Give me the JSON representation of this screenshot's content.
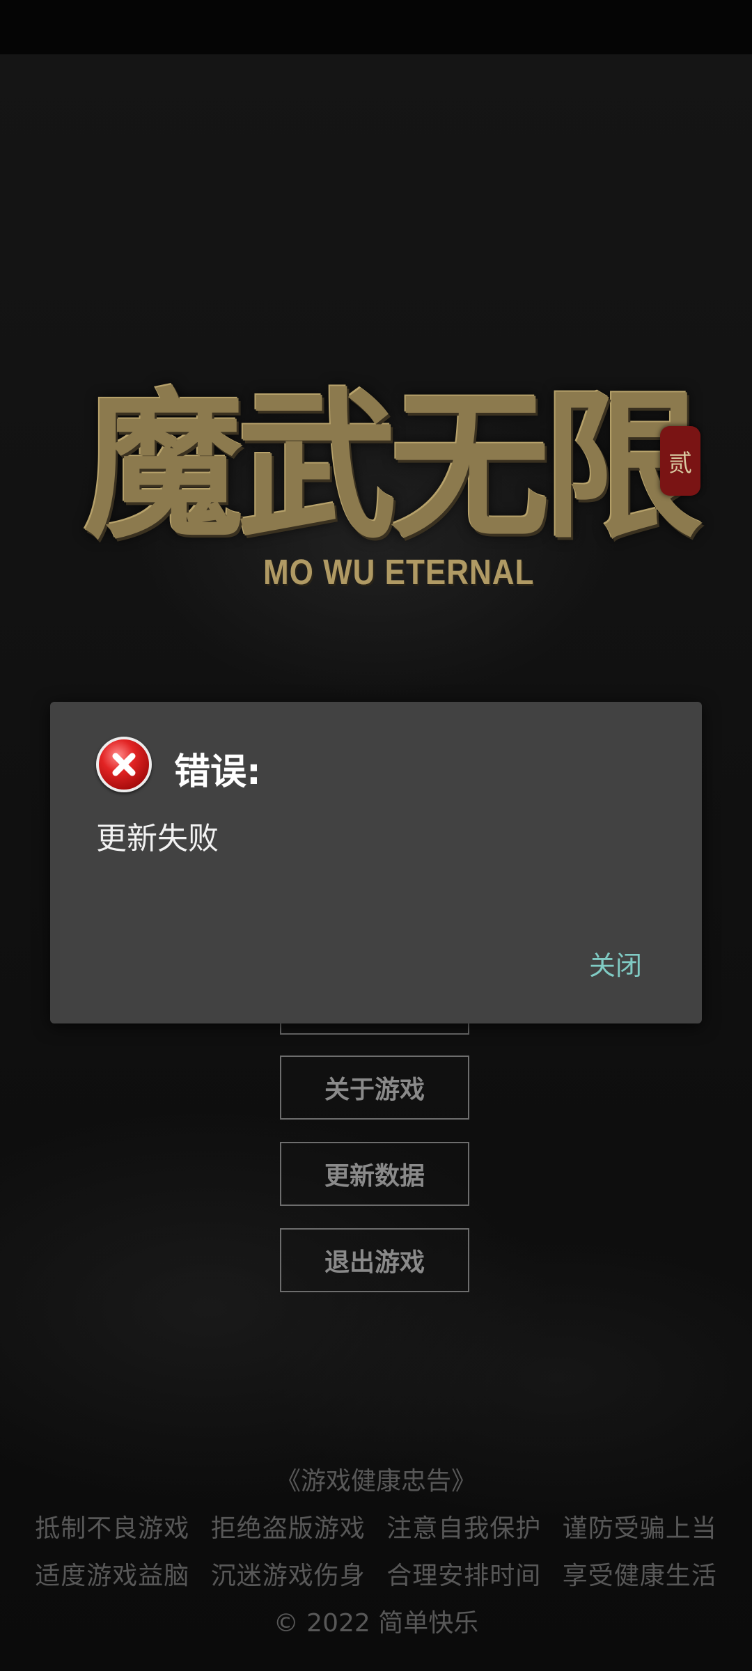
{
  "logo": {
    "title": "魔武无限",
    "subtitle": "MO WU ETERNAL",
    "seal": "贰"
  },
  "menu": {
    "hidden_item": "",
    "about": "关于游戏",
    "update": "更新数据",
    "exit": "退出游戏"
  },
  "dialog": {
    "icon": "error-icon",
    "title": "错误:",
    "message": "更新失败",
    "close_label": "关闭"
  },
  "footer": {
    "title": "《游戏健康忠告》",
    "line1": [
      "抵制不良游戏",
      "拒绝盗版游戏",
      "注意自我保护",
      "谨防受骗上当"
    ],
    "line2": [
      "适度游戏益脑",
      "沉迷游戏伤身",
      "合理安排时间",
      "享受健康生活"
    ],
    "copyright": "©  2022  简单快乐"
  },
  "colors": {
    "dialog_bg": "#424242",
    "accent": "#80cbc4",
    "logo_gold": "#8c7a4e"
  }
}
